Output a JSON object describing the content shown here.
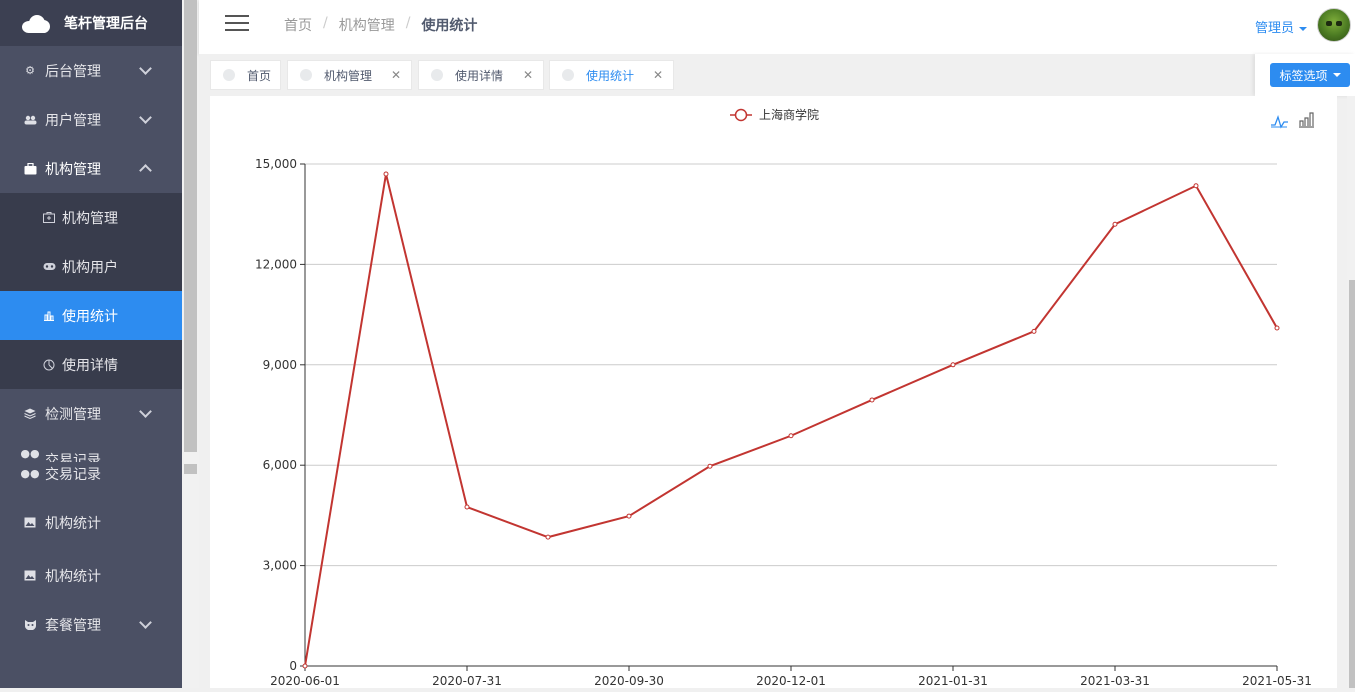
{
  "sidebar": {
    "title": "笔杆管理后台",
    "items": [
      {
        "label": "后台管理",
        "icon": "gear-icon"
      },
      {
        "label": "用户管理",
        "icon": "users-icon"
      },
      {
        "label": "机构管理",
        "icon": "briefcase-icon"
      },
      {
        "label": "检测管理",
        "icon": "layers-icon"
      },
      {
        "label": "交易记录",
        "icon": "chat-icon"
      },
      {
        "label": "交易记录",
        "icon": "chat-icon"
      },
      {
        "label": "机构统计",
        "icon": "image-icon"
      },
      {
        "label": "机构统计",
        "icon": "image-icon"
      },
      {
        "label": "套餐管理",
        "icon": "cat-icon"
      }
    ],
    "submenu": [
      {
        "label": "机构管理",
        "icon": "medkit-icon"
      },
      {
        "label": "机构用户",
        "icon": "gamepad-icon"
      },
      {
        "label": "使用统计",
        "icon": "bar-chart-icon",
        "active": true
      },
      {
        "label": "使用详情",
        "icon": "pie-chart-icon"
      }
    ]
  },
  "header": {
    "breadcrumb": [
      "首页",
      "机构管理",
      "使用统计"
    ],
    "user": "管理员"
  },
  "tabs": [
    {
      "label": "首页",
      "closable": false
    },
    {
      "label": "机构管理",
      "closable": true
    },
    {
      "label": "使用详情",
      "closable": true
    },
    {
      "label": "使用统计",
      "closable": true,
      "active": true
    }
  ],
  "tab_options_label": "标签选项",
  "chart_data": {
    "type": "line",
    "x": [
      "2020-06-01",
      "2020-07-01",
      "2020-07-31",
      "2020-08-31",
      "2020-09-30",
      "2020-10-31",
      "2020-12-01",
      "2020-12-31",
      "2021-01-31",
      "2021-03-01",
      "2021-03-31",
      "2021-05-01",
      "2021-05-31"
    ],
    "xtick_labels": [
      "2020-06-01",
      "2020-07-31",
      "2020-09-30",
      "2020-12-01",
      "2021-01-31",
      "2021-03-31",
      "2021-05-31"
    ],
    "series": [
      {
        "name": "上海商学院",
        "color": "#c23531",
        "values": [
          0,
          14700,
          4750,
          3850,
          4480,
          5970,
          6880,
          7950,
          9000,
          10000,
          13200,
          14350,
          10100
        ]
      }
    ],
    "ylim": [
      0,
      15000
    ],
    "yticks": [
      "0",
      "3,000",
      "6,000",
      "9,000",
      "12,000",
      "15,000"
    ],
    "grid": true,
    "legend_position": "top-center",
    "toolbox": [
      "line-chart-icon",
      "bar-chart-icon"
    ]
  }
}
